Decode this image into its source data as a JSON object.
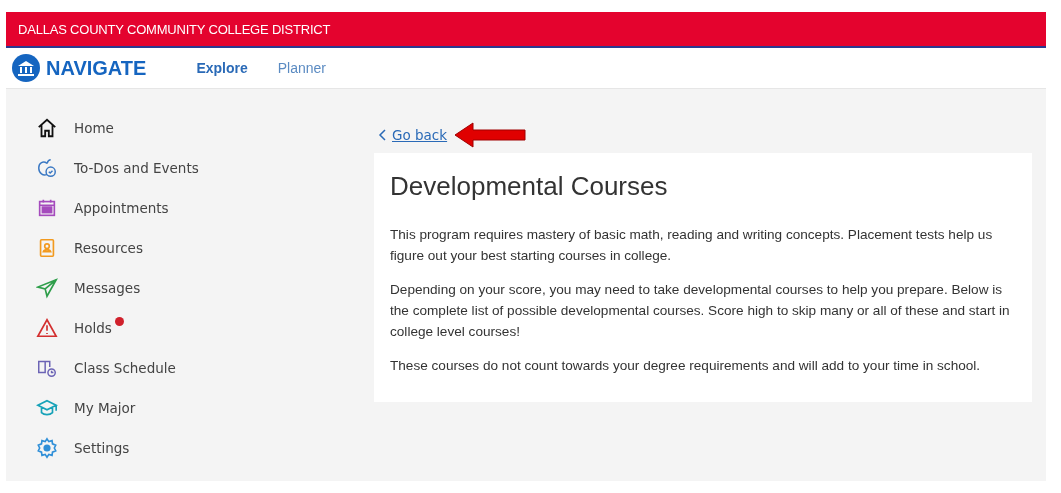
{
  "banner": {
    "title": "DALLAS COUNTY COMMUNITY COLLEGE DISTRICT"
  },
  "header": {
    "logo": "NAVIGATE",
    "tabs": [
      {
        "label": "Explore",
        "selected": true
      },
      {
        "label": "Planner",
        "selected": false
      }
    ]
  },
  "sidebar": {
    "items": [
      {
        "label": "Home",
        "alert": false
      },
      {
        "label": "To-Dos and Events",
        "alert": false
      },
      {
        "label": "Appointments",
        "alert": false
      },
      {
        "label": "Resources",
        "alert": false
      },
      {
        "label": "Messages",
        "alert": false
      },
      {
        "label": "Holds",
        "alert": true
      },
      {
        "label": "Class Schedule",
        "alert": false
      },
      {
        "label": "My Major",
        "alert": false
      },
      {
        "label": "Settings",
        "alert": false
      }
    ]
  },
  "content": {
    "back_link": "Go back",
    "title": "Developmental Courses",
    "paragraphs": [
      "This program requires mastery of basic math, reading and writing concepts. Placement tests help us figure out your best starting courses in college.",
      "Depending on your score, you may need to take developmental courses to help you prepare. Below is the complete list of possible developmental courses. Score high to skip many or all of these and start in college level courses!",
      "These courses do not count towards your degree requirements and will add to your time in school."
    ]
  }
}
